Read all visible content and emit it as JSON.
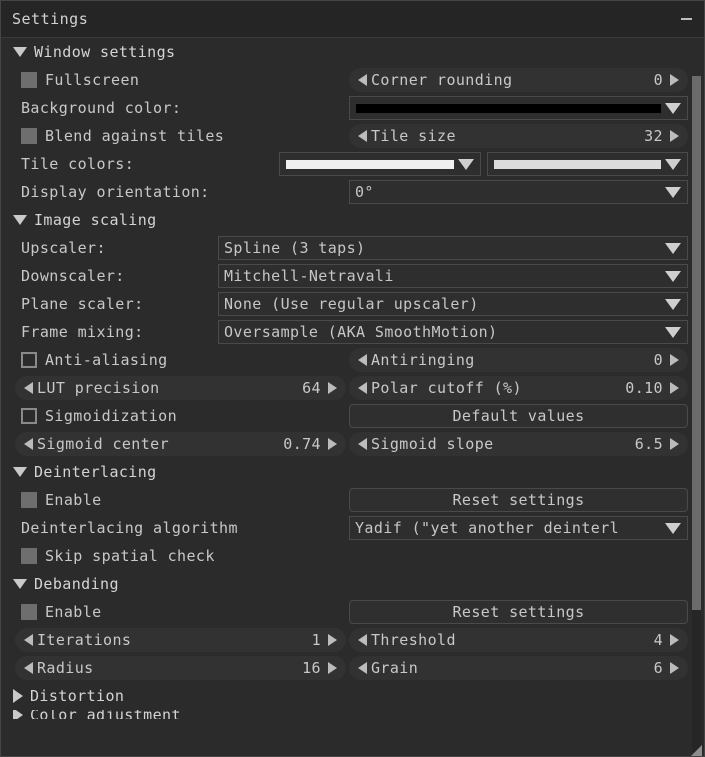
{
  "window": {
    "title": "Settings",
    "minimize_label": "–"
  },
  "colors": {
    "window_bg": "#2b2b2b",
    "titlebar_bg": "#252525",
    "text": "#c8c8c8",
    "scrollbar_thumb": "#6b6b6b",
    "background_color_swatch": "#000000",
    "tile_color_1": "#f0f0f0",
    "tile_color_2": "#dcdcdc"
  },
  "sections": {
    "window_settings": {
      "label": "Window settings",
      "expanded": true,
      "triangle": "triangle-down-icon"
    },
    "image_scaling": {
      "label": "Image scaling",
      "expanded": true,
      "triangle": "triangle-down-icon"
    },
    "deinterlacing": {
      "label": "Deinterlacing",
      "expanded": true,
      "triangle": "triangle-down-icon"
    },
    "debanding": {
      "label": "Debanding",
      "expanded": true,
      "triangle": "triangle-down-icon"
    },
    "distortion": {
      "label": "Distortion",
      "expanded": false,
      "triangle": "triangle-right-icon"
    },
    "color_adjustment": {
      "label": "Color adjustment",
      "expanded": false,
      "triangle": "triangle-right-icon"
    }
  },
  "window_settings": {
    "fullscreen": {
      "label": "Fullscreen",
      "checked": false
    },
    "corner_rounding": {
      "label": "Corner rounding",
      "value": "0"
    },
    "background_color": {
      "label": "Background color:",
      "swatch": "#000000"
    },
    "blend_against_tiles": {
      "label": "Blend against tiles",
      "checked": false
    },
    "tile_size": {
      "label": "Tile size",
      "value": "32"
    },
    "tile_colors": {
      "label": "Tile colors:",
      "swatch_1": "#f0f0f0",
      "swatch_2": "#dcdcdc"
    },
    "display_orientation": {
      "label": "Display orientation:",
      "value": "0°"
    }
  },
  "image_scaling": {
    "upscaler": {
      "label": "Upscaler:",
      "value": "Spline (3 taps)"
    },
    "downscaler": {
      "label": "Downscaler:",
      "value": "Mitchell-Netravali"
    },
    "plane_scaler": {
      "label": "Plane scaler:",
      "value": "None (Use regular upscaler)"
    },
    "frame_mixing": {
      "label": "Frame mixing:",
      "value": "Oversample (AKA SmoothMotion)"
    },
    "anti_aliasing": {
      "label": "Anti-aliasing",
      "checked": false
    },
    "antiringing": {
      "label": "Antiringing",
      "value": "0"
    },
    "lut_precision": {
      "label": "LUT precision",
      "value": "64"
    },
    "polar_cutoff": {
      "label": "Polar cutoff (%)",
      "value": "0.10"
    },
    "sigmoidization": {
      "label": "Sigmoidization",
      "checked": false
    },
    "default_values": {
      "label": "Default values"
    },
    "sigmoid_center": {
      "label": "Sigmoid center",
      "value": "0.74"
    },
    "sigmoid_slope": {
      "label": "Sigmoid slope",
      "value": "6.5"
    }
  },
  "deinterlacing": {
    "enable": {
      "label": "Enable",
      "checked": false
    },
    "reset_settings": {
      "label": "Reset settings"
    },
    "algorithm": {
      "label": "Deinterlacing algorithm",
      "value": "Yadif (\"yet another deinterl"
    },
    "skip_spatial_check": {
      "label": "Skip spatial check",
      "checked": false
    }
  },
  "debanding": {
    "enable": {
      "label": "Enable",
      "checked": false
    },
    "reset_settings": {
      "label": "Reset settings"
    },
    "iterations": {
      "label": "Iterations",
      "value": "1"
    },
    "threshold": {
      "label": "Threshold",
      "value": "4"
    },
    "radius": {
      "label": "Radius",
      "value": "16"
    },
    "grain": {
      "label": "Grain",
      "value": "6"
    }
  },
  "icons": {
    "minimize": "minimize-icon",
    "dropdown_arrow": "chevron-down-icon",
    "spin_left": "arrow-left-icon",
    "spin_right": "arrow-right-icon",
    "resize_grip": "resize-grip-icon"
  }
}
